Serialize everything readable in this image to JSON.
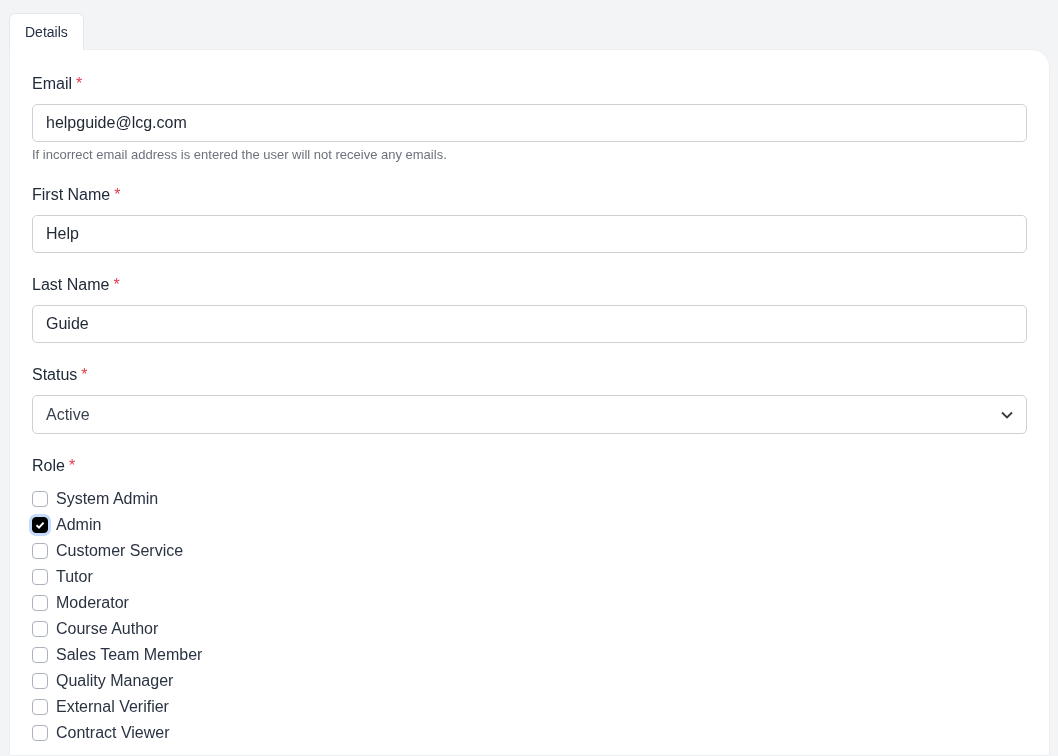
{
  "tabs": [
    {
      "label": "Details",
      "selected": true
    }
  ],
  "fields": [
    {
      "kind": "text",
      "label": "Email",
      "required": "*",
      "value": "helpguide@lcg.com",
      "hint": "If incorrect email address is entered the user will not receive any emails."
    },
    {
      "kind": "text",
      "label": "First Name",
      "required": "*",
      "value": "Help"
    },
    {
      "kind": "text",
      "label": "Last Name",
      "required": "*",
      "value": "Guide"
    },
    {
      "kind": "select",
      "label": "Status",
      "required": "*",
      "value": "Active"
    },
    {
      "kind": "checkboxes",
      "label": "Role",
      "required": "*",
      "options": [
        {
          "label": "System Admin",
          "checked": false
        },
        {
          "label": "Admin",
          "checked": true
        },
        {
          "label": "Customer Service",
          "checked": false
        },
        {
          "label": "Tutor",
          "checked": false
        },
        {
          "label": "Moderator",
          "checked": false
        },
        {
          "label": "Course Author",
          "checked": false
        },
        {
          "label": "Sales Team Member",
          "checked": false
        },
        {
          "label": "Quality Manager",
          "checked": false
        },
        {
          "label": "External Verifier",
          "checked": false
        },
        {
          "label": "Contract Viewer",
          "checked": false
        }
      ]
    }
  ]
}
